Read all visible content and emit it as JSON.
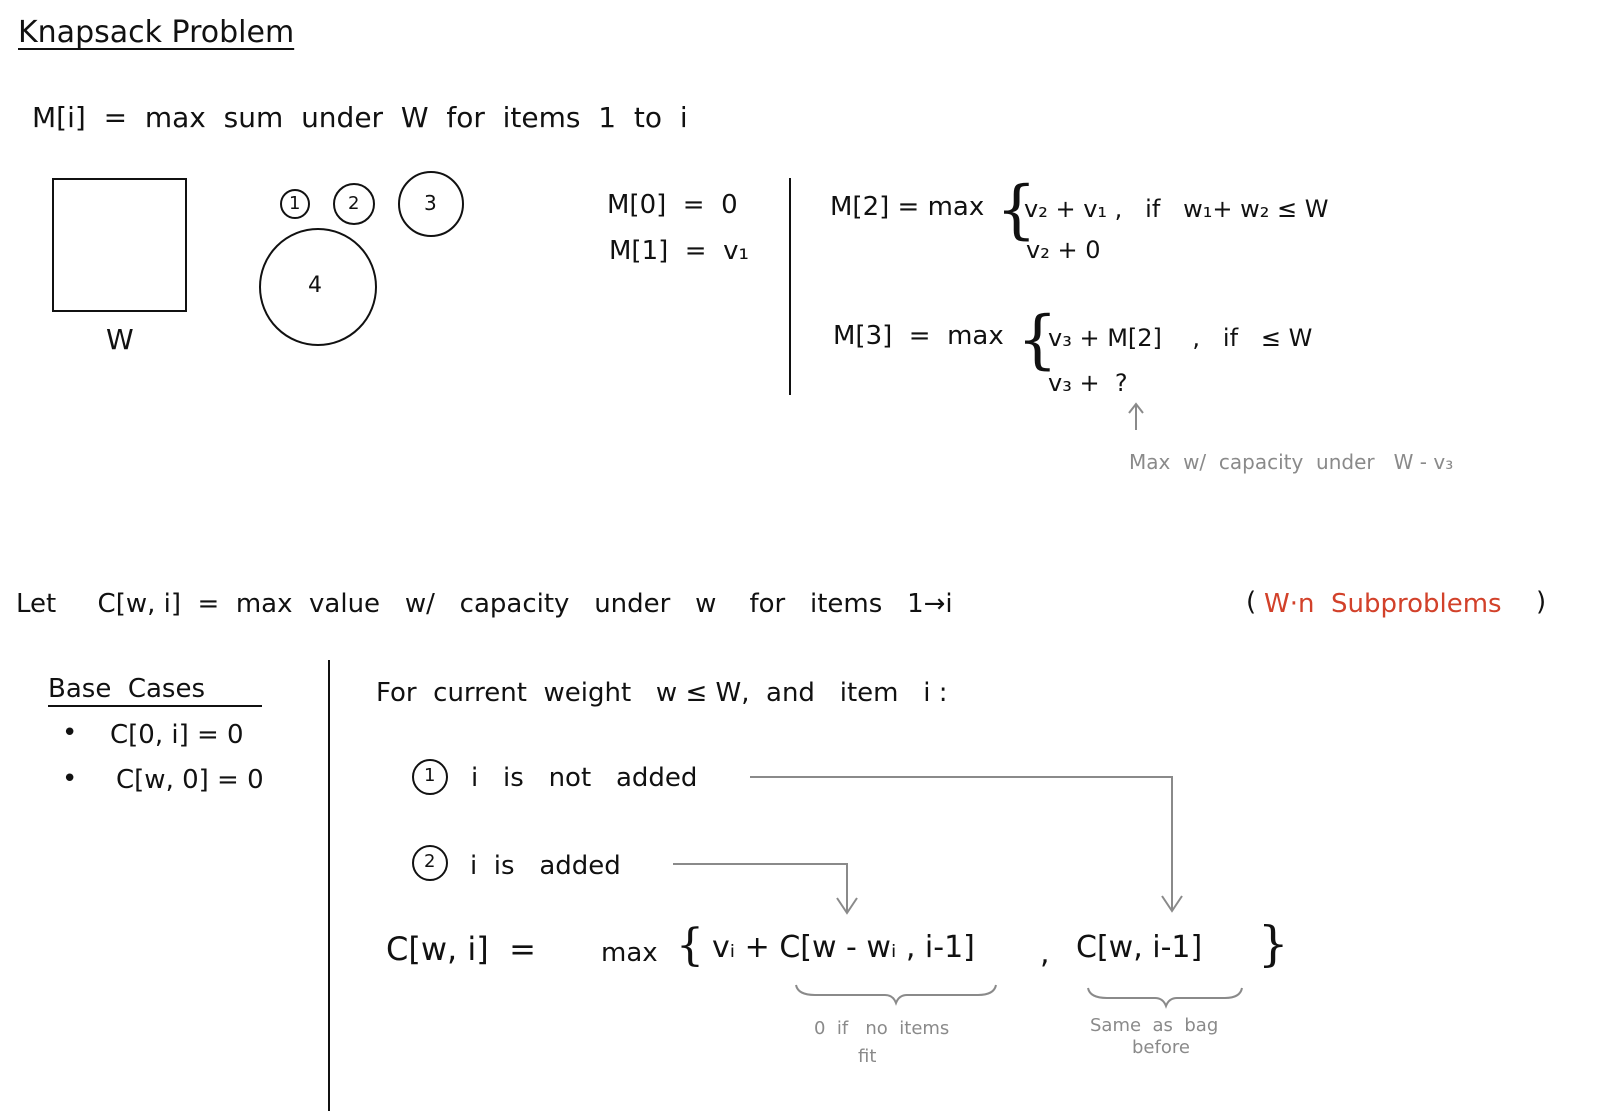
{
  "title": "Knapsack Problem",
  "definition": "M[i]  =  max  sum  under  W  for  items  1  to  i",
  "figure": {
    "box_label": "W",
    "item_labels": [
      "1",
      "2",
      "3",
      "4"
    ]
  },
  "base_m": {
    "m0": "M[0]  =  0",
    "m1": "M[1]  =  v₁"
  },
  "m2": {
    "lhs": "M[2] = max",
    "case1": "v₂ + v₁ ,   if   w₁+ w₂ ≤ W",
    "case2": "v₂ + 0"
  },
  "m3": {
    "lhs": "M[3]  =  max",
    "case1": "v₃ + M[2]    ,   if   ≤ W",
    "case2": "v₃ +  ?",
    "note": "Max  w/  capacity  under   W - v₃"
  },
  "let": {
    "text": "Let     C[w, i]  =  max  value   w/   capacity   under   w    for   items   1→i",
    "paren_open": "(",
    "subproblems": "W·n  Subproblems",
    "paren_close": ")"
  },
  "base_cases": {
    "heading": "Base  Cases",
    "items": [
      "C[0, i] = 0",
      "C[w, 0] = 0"
    ]
  },
  "recurrence": {
    "intro": "For  current  weight   w ≤ W,  and   item   i :",
    "option1_num": "1",
    "option1": "i   is   not   added",
    "option2_num": "2",
    "option2": "i  is   added",
    "lhs": "C[w, i]  =",
    "max": "max",
    "term1": "vᵢ + C[w - wᵢ , i-1]",
    "comma": ",",
    "term2": "C[w, i-1]",
    "note1_line1": "0  if   no  items",
    "note1_line2": "fit",
    "note2_line1": "Same  as  bag",
    "note2_line2": "before"
  },
  "colors": {
    "ink": "#111111",
    "gray": "#8a8a8a",
    "accent": "#d2412a"
  }
}
